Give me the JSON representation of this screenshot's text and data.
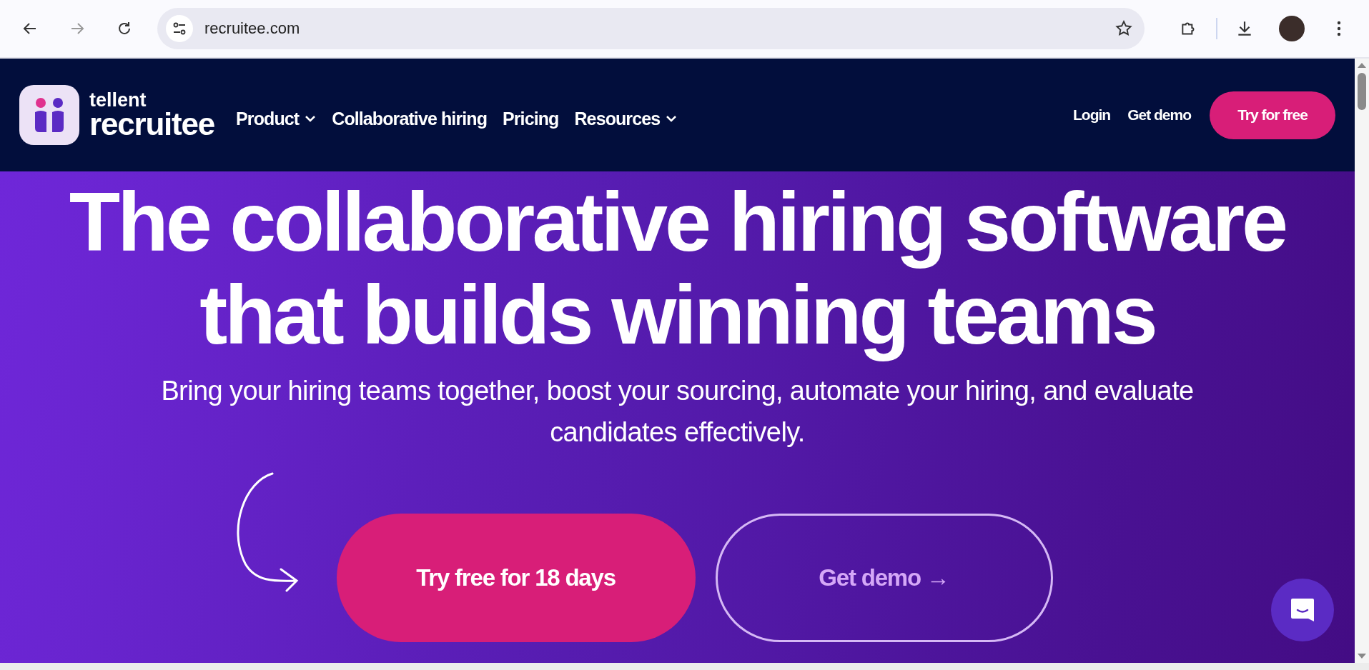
{
  "browser": {
    "url": "recruitee.com"
  },
  "nav": {
    "logo_top": "tellent",
    "logo_bottom": "recruitee",
    "items": [
      {
        "label": "Product",
        "has_menu": true
      },
      {
        "label": "Collaborative hiring",
        "has_menu": false
      },
      {
        "label": "Pricing",
        "has_menu": false
      },
      {
        "label": "Resources",
        "has_menu": true
      }
    ],
    "login": "Login",
    "demo": "Get demo",
    "cta": "Try for free"
  },
  "hero": {
    "title_lines": [
      "The collaborative hiring software",
      "that builds winning teams"
    ],
    "subtitle": "Bring your hiring teams together, boost your sourcing, automate your hiring, and evaluate candidates effectively.",
    "primary_button": "Try free for 18 days",
    "secondary_button": "Get demo →"
  }
}
